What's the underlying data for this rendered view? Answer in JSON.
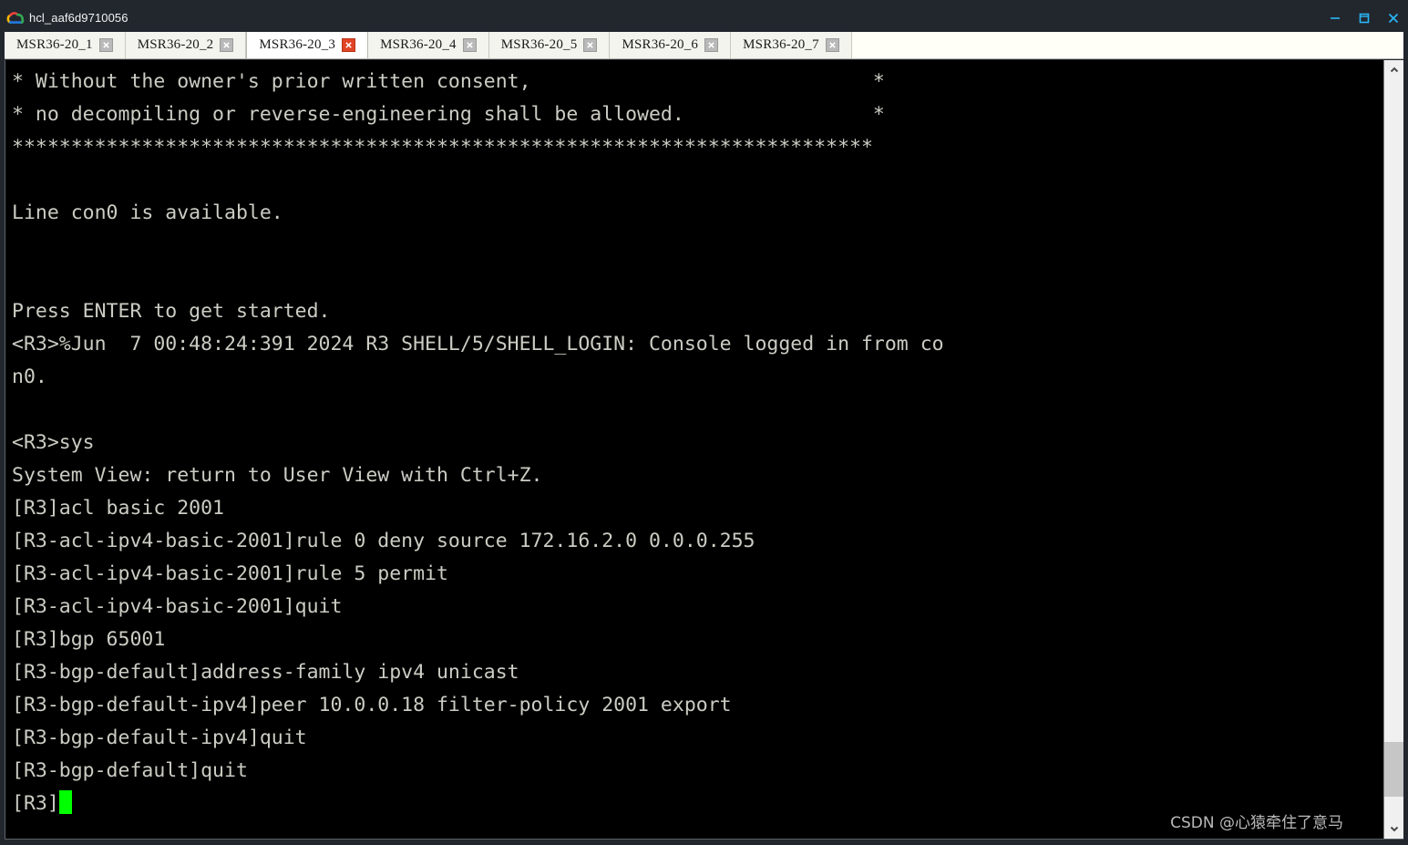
{
  "window": {
    "title": "hcl_aaf6d9710056",
    "logo_icon": "cloud-icon",
    "controls": {
      "minimize": "minimize-icon",
      "maximize": "maximize-icon",
      "close": "close-icon"
    },
    "accent_color": "#29b6f6",
    "titlebar_color": "#22272e"
  },
  "tabs": [
    {
      "label": "MSR36-20_1",
      "active": false
    },
    {
      "label": "MSR36-20_2",
      "active": false
    },
    {
      "label": "MSR36-20_3",
      "active": true
    },
    {
      "label": "MSR36-20_4",
      "active": false
    },
    {
      "label": "MSR36-20_5",
      "active": false
    },
    {
      "label": "MSR36-20_6",
      "active": false
    },
    {
      "label": "MSR36-20_7",
      "active": false
    }
  ],
  "terminal": {
    "foreground": "#ccccc4",
    "background": "#000000",
    "cursor_color": "#00ff00",
    "lines": [
      "* Without the owner's prior written consent,                             *",
      "* no decompiling or reverse-engineering shall be allowed.                *",
      "*************************************************************************",
      "",
      "Line con0 is available.",
      "",
      "",
      "Press ENTER to get started.",
      "<R3>%Jun  7 00:48:24:391 2024 R3 SHELL/5/SHELL_LOGIN: Console logged in from co",
      "n0.",
      "",
      "<R3>sys",
      "System View: return to User View with Ctrl+Z.",
      "[R3]acl basic 2001",
      "[R3-acl-ipv4-basic-2001]rule 0 deny source 172.16.2.0 0.0.0.255",
      "[R3-acl-ipv4-basic-2001]rule 5 permit",
      "[R3-acl-ipv4-basic-2001]quit",
      "[R3]bgp 65001",
      "[R3-bgp-default]address-family ipv4 unicast",
      "[R3-bgp-default-ipv4]peer 10.0.0.18 filter-policy 2001 export",
      "[R3-bgp-default-ipv4]quit",
      "[R3-bgp-default]quit"
    ],
    "prompt": "[R3]"
  },
  "scrollbar": {
    "up_arrow": "chevron-up-icon",
    "down_arrow": "chevron-down-icon"
  },
  "watermark": "CSDN @心猿牵住了意马"
}
